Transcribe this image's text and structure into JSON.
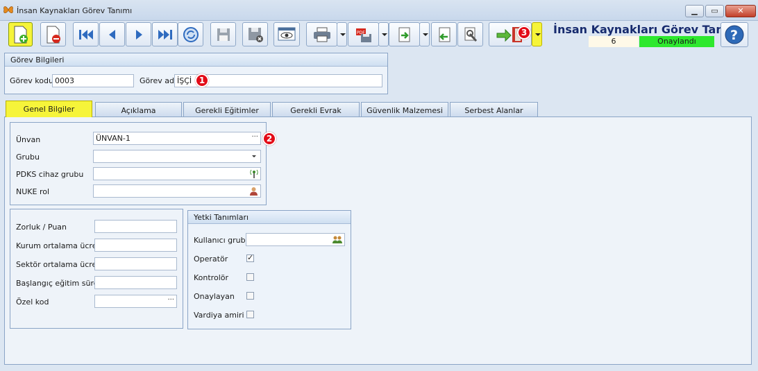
{
  "window": {
    "title": "İnsan Kaynakları Görev Tanımı"
  },
  "header": {
    "form_title": "İnsan Kaynakları Görev Tanımı",
    "record_count": "6",
    "status": "Onaylandı"
  },
  "toolbar": {
    "buttons": [
      "new-record-icon",
      "delete-record-icon",
      "first-record-icon",
      "previous-record-icon",
      "next-record-icon",
      "last-record-icon",
      "refresh-icon",
      "save-icon",
      "cancel-save-icon",
      "preview-icon",
      "print-icon",
      "pdf-export-icon",
      "export-icon",
      "import-icon",
      "settings-wrench-icon",
      "exit-door-icon",
      "help-icon"
    ]
  },
  "badges": {
    "one": "1",
    "two": "2",
    "three": "3"
  },
  "gorev_bilgileri": {
    "title": "Görev Bilgileri",
    "kod_label": "Görev kodu",
    "kod_value": "0003",
    "ad_label": "Görev adı",
    "ad_value": "İŞÇİ"
  },
  "tabs": [
    "Genel Bilgiler",
    "Açıklama",
    "Gerekli Eğitimler",
    "Gerekli Evrak",
    "Güvenlik Malzemesi",
    "Serbest Alanlar"
  ],
  "genel": {
    "unvan_label": "Ünvan",
    "unvan_value": "ÜNVAN-1",
    "grubu_label": "Grubu",
    "grubu_value": "",
    "pdks_label": "PDKS cihaz grubu",
    "pdks_value": "",
    "nuke_label": "NUKE rol",
    "nuke_value": ""
  },
  "puan": {
    "zorluk_label": "Zorluk / Puan",
    "kurum_label": "Kurum ortalama ücret",
    "sektor_label": "Sektör ortalama ücret",
    "egitim_label": "Başlangıç eğitim süresi",
    "ozel_label": "Özel kod"
  },
  "yetki": {
    "title": "Yetki Tanımları",
    "kullanici_label": "Kullanıcı grubu",
    "operator_label": "Operatör",
    "operator_checked": true,
    "kontrolor_label": "Kontrolör",
    "kontrolor_checked": false,
    "onaylayan_label": "Onaylayan",
    "onaylayan_checked": false,
    "vardiya_label": "Vardiya amiri",
    "vardiya_checked": false
  },
  "colors": {
    "highlight": "#f6f43a",
    "status_green": "#2ee82e",
    "badge_red": "#e30b17",
    "title_navy": "#172b6e"
  }
}
